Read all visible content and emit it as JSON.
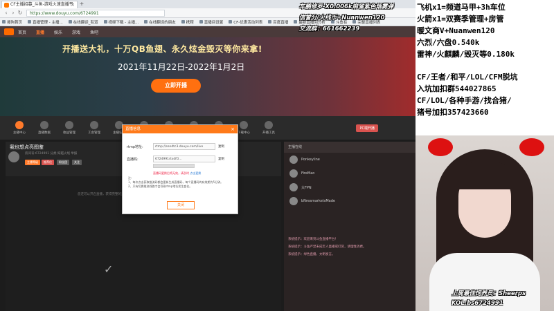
{
  "browser": {
    "tab_title": "CF主播招募_斗鱼-游戏火速直播平",
    "new_tab": "+",
    "url": "https://www.douyu.com/6724991",
    "bookmarks": [
      "搜狗首页",
      "直播管理 - 主播...",
      "在线翻译_有道",
      "视频下载 - 主播...",
      "在线翻译的朋友",
      "携程",
      "直播间设置",
      "CF-优惠活动列表",
      "百度直播",
      "最新直播间分析",
      "斗鱼有",
      "完整直播列表"
    ]
  },
  "site": {
    "nav": [
      "首页",
      "直播",
      "娱乐",
      "游戏",
      "鱼吧"
    ],
    "banner_slogan": "开播送大礼，十万QB鱼翅、永久炫金毁灭等你来拿!",
    "banner_dates": "2021年11月22日-2022年1月2日",
    "banner_cta": "立即开播",
    "categories": [
      "主播中心",
      "直播数据",
      "收益管理",
      "工会管理",
      "主播任务",
      "粉丝管理",
      "我的鱼吧",
      "主播认证",
      "贵族管理",
      "下载中心",
      "开播工具"
    ],
    "pc_button": "PC端开播",
    "room_title": "我也想点亮图鉴",
    "room_meta": "房间号:6724991  分类:穿越火线  举报",
    "badges": [
      "主播等级",
      "推荐位",
      "粉丝团",
      "关注"
    ],
    "notice": "您还可以开启直播，获得完整的直播间体验",
    "notice_link": "开启直播"
  },
  "modal": {
    "title": "直播信息",
    "close": "×",
    "rtmp_label": "rtmp地址:",
    "rtmp_value": "rtmp://sendtc3.douyu.com/live",
    "code_label": "直播码:",
    "code_value": "6724991rtxdfO...",
    "copy1": "复制",
    "copy2": "复制",
    "warning": "直播码更换后将无效，请及时",
    "warning_link": "点击更换",
    "notes": "注:\n1、每次点击获取推流码都会更新生成直播码，每个直播码的有效期为5分钟。\n2、只有切换推流线路才会导致rtmp地址发生变化。",
    "ok_button": "关闭"
  },
  "chat": {
    "header": "主播在线",
    "ranks": [
      "Ponkeyline",
      "FireMao",
      "大FPN",
      "bNreamarketsMade"
    ],
    "messages": [
      "系统提示：欢迎来到斗鱼直播平台！",
      "系统提示：斗鱼严禁未成年人直播或打赏，请理性消费。",
      "系统提示：绿色直播，文明发言。"
    ]
  },
  "overlay_left": [
    "车鹏修罗-X0.006k麻雀紫色烟雾弹",
    "信誉分/火线币+Nuanwen120",
    "交流群：661662239"
  ],
  "overlay_right_1": [
    "飞机x1=频道马甲+3h车位",
    "火箭x1=双赛季管理+房管",
    "暖文商V+Nuanwen120",
    "六烈/六盘0.540k",
    "雷神/火麒麟/毁灭等0.180k"
  ],
  "overlay_right_2": [
    "CF/王者/和平/LOL/CFM脱坑",
    "入坑加扣群544027865",
    "CF/LOL/各种手游/找合猪/",
    "猪号加扣357423660"
  ],
  "cam": {
    "caption1": "上周最佳饲养员：Sheerps",
    "caption2": "KOL:bs6724991"
  }
}
